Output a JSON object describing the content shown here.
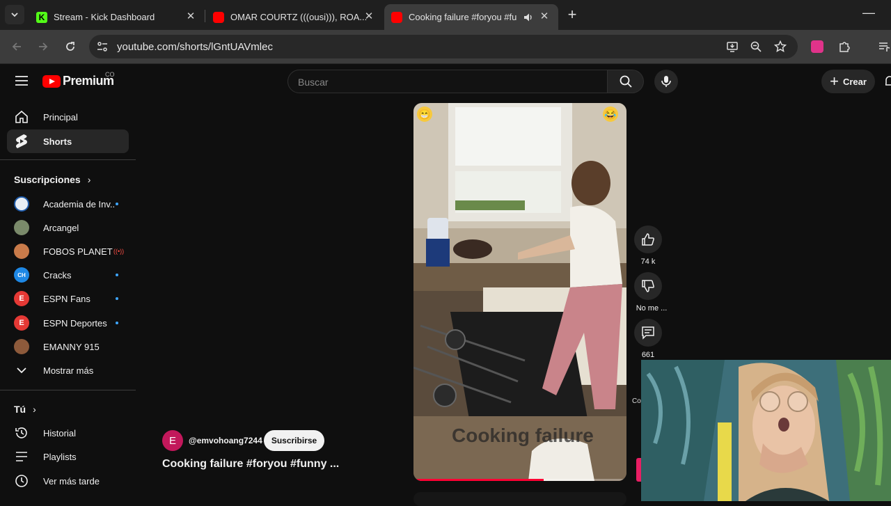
{
  "browser": {
    "tabs": [
      {
        "title": "Stream - Kick Dashboard",
        "favicon_color": "#53fc18",
        "favicon": "kick-icon",
        "active": false
      },
      {
        "title": "OMAR COURTZ (((ousi))), ROA...",
        "favicon_color": "#ff0000",
        "favicon": "youtube-icon",
        "active": false
      },
      {
        "title": "Cooking failure #foryou #fu",
        "favicon_color": "#ff0000",
        "favicon": "youtube-icon",
        "active": true
      }
    ],
    "url": "youtube.com/shorts/lGntUAVmlec"
  },
  "youtube": {
    "logo_text": "Premium",
    "country_code": "CO",
    "search_placeholder": "Buscar",
    "create_label": "Crear"
  },
  "sidebar": {
    "main": [
      {
        "label": "Principal",
        "icon": "home-icon"
      },
      {
        "label": "Shorts",
        "icon": "shorts-icon",
        "selected": true
      }
    ],
    "subscriptions_heading": "Suscripciones",
    "subscriptions": [
      {
        "label": "Academia de Inv...",
        "avatar_color": "#e8eef5",
        "avatar_text": "",
        "indicator": "dot"
      },
      {
        "label": "Arcangel",
        "avatar_color": "#7a8a6a",
        "avatar_text": "",
        "indicator": "none"
      },
      {
        "label": "FOBOS PLANET",
        "avatar_color": "#c97b4a",
        "avatar_text": "",
        "indicator": "live"
      },
      {
        "label": "Cracks",
        "avatar_color": "#1e88e5",
        "avatar_text": "CH",
        "indicator": "dot"
      },
      {
        "label": "ESPN Fans",
        "avatar_color": "#e53935",
        "avatar_text": "E",
        "indicator": "dot"
      },
      {
        "label": "ESPN Deportes",
        "avatar_color": "#e53935",
        "avatar_text": "E",
        "indicator": "dot"
      },
      {
        "label": "EMANNY 915",
        "avatar_color": "#8d5a3b",
        "avatar_text": "",
        "indicator": "none"
      }
    ],
    "show_more": "Mostrar más",
    "you_heading": "Tú",
    "you_items": [
      {
        "label": "Historial",
        "icon": "history-icon"
      },
      {
        "label": "Playlists",
        "icon": "playlists-icon"
      },
      {
        "label": "Ver más tarde",
        "icon": "watch-later-icon"
      }
    ]
  },
  "short": {
    "progress": 0.61,
    "caption_overlay": "Cooking failure",
    "channel_initial": "E",
    "channel_handle": "@emvohoang7244",
    "subscribe_label": "Suscribirse",
    "title": "Cooking failure #foryou #funny ...",
    "actions": {
      "likes": "74 k",
      "dislike_label": "No me ...",
      "comments": "661",
      "partial_label": "Co"
    }
  }
}
